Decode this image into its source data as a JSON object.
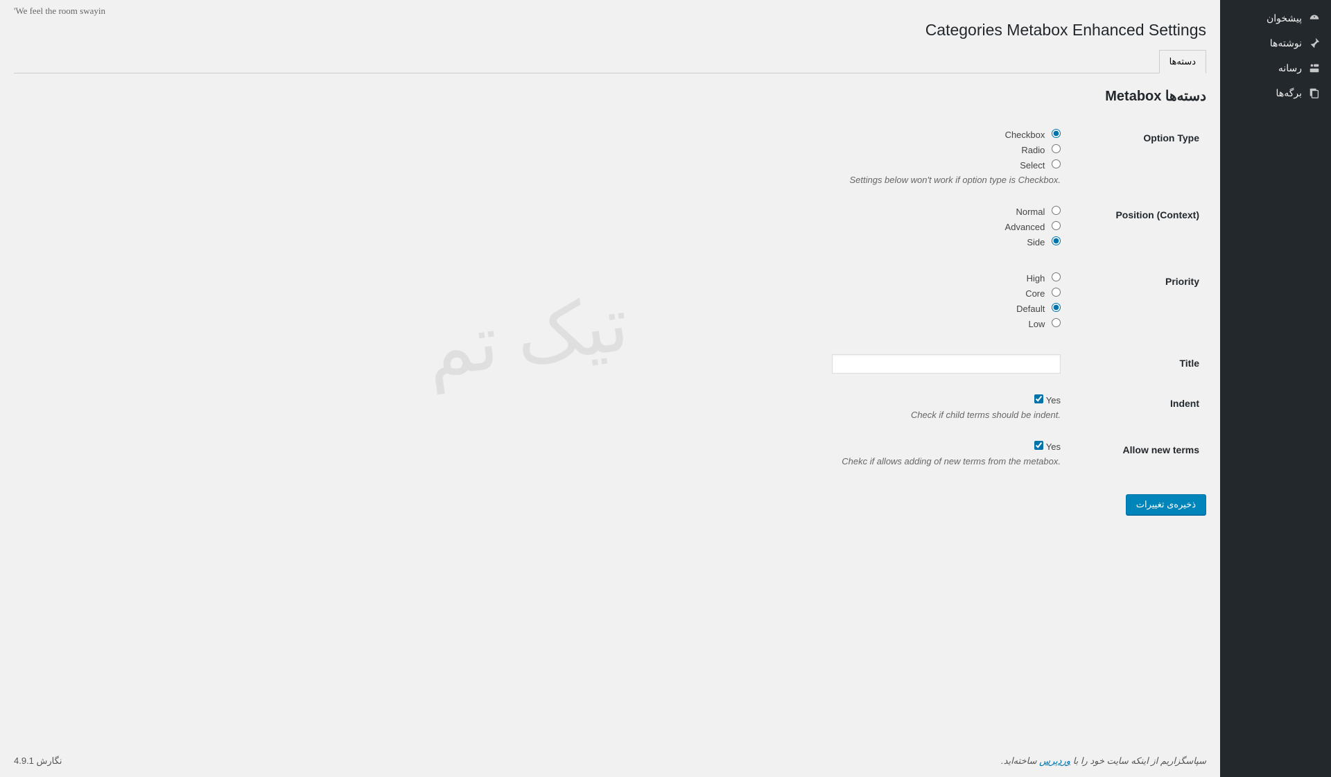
{
  "top_quote": "'We feel the room swayin",
  "sidebar": {
    "items": [
      {
        "label": "پیشخوان",
        "icon": "dashboard"
      },
      {
        "label": "نوشته‌ها",
        "icon": "pin"
      },
      {
        "label": "رسانه",
        "icon": "media"
      },
      {
        "label": "برگه‌ها",
        "icon": "page"
      }
    ]
  },
  "page": {
    "title": "Categories Metabox Enhanced Settings",
    "active_tab": "دسته‌ها",
    "section_heading": "دسته‌ها Metabox"
  },
  "fields": {
    "option_type": {
      "label": "Option Type",
      "options": [
        "Checkbox",
        "Radio",
        "Select"
      ],
      "selected": "Checkbox",
      "description": "Settings below won't work if option type is Checkbox."
    },
    "position": {
      "label": "Position (Context)",
      "options": [
        "Normal",
        "Advanced",
        "Side"
      ],
      "selected": "Side"
    },
    "priority": {
      "label": "Priority",
      "options": [
        "High",
        "Core",
        "Default",
        "Low"
      ],
      "selected": "Default"
    },
    "title": {
      "label": "Title",
      "value": ""
    },
    "indent": {
      "label": "Indent",
      "checkbox_label": "Yes",
      "checked": true,
      "description": "Check if child terms should be indent."
    },
    "allow_new": {
      "label": "Allow new terms",
      "checkbox_label": "Yes",
      "checked": true,
      "description": "Chekc if allows adding of new terms from the metabox."
    }
  },
  "submit_label": "ذخیره‌ی تغییرات",
  "footer": {
    "thanks_prefix": "سپاسگزاریم از اینکه سایت خود را با ",
    "link_text": "وردپرس",
    "thanks_suffix": " ساخته‌اید.",
    "version": "نگارش 4.9.1"
  },
  "watermark": "تیک تم"
}
